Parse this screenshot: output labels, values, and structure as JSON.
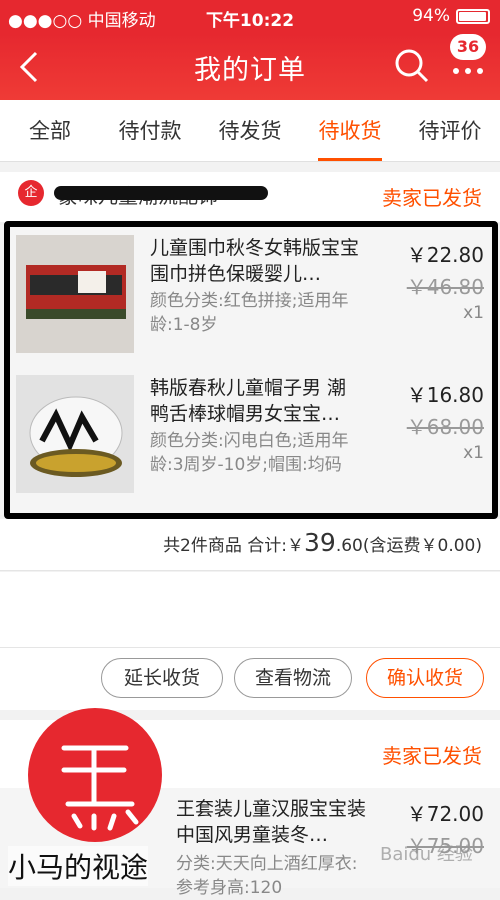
{
  "status_bar": {
    "carrier": "●●●○○ 中国移动",
    "time": "下午10:22",
    "battery": "94%"
  },
  "nav": {
    "back_icon": "chevron-left-icon",
    "title": "我的订单",
    "badge_count": "36"
  },
  "tabs": [
    {
      "label": "全部"
    },
    {
      "label": "待付款"
    },
    {
      "label": "待发货"
    },
    {
      "label": "待收货",
      "active": true
    },
    {
      "label": "待评价"
    }
  ],
  "order1": {
    "shop_icon_text": "企",
    "shop_name": "蒙味儿童潮流配饰",
    "status": "卖家已发货",
    "items": [
      {
        "title": "儿童围巾秋冬女韩版宝宝围巾拼色保暖婴儿…",
        "spec": "颜色分类:红色拼接;适用年龄:1-8岁",
        "price": "￥22.80",
        "original_price": "￥46.80",
        "quantity": "x1"
      },
      {
        "title": "韩版春秋儿童帽子男 潮鸭舌棒球帽男女宝宝…",
        "spec": "颜色分类:闪电白色;适用年龄:3周岁-10岁;帽围:均码",
        "price": "￥16.80",
        "original_price": "￥68.00",
        "quantity": "x1"
      }
    ],
    "summary_prefix": "共2件商品 合计:￥",
    "total_int": "39",
    "total_dec": ".60",
    "summary_suffix": "(含运费￥0.00)",
    "buttons": {
      "extend": "延长收货",
      "logistics": "查看物流",
      "confirm": "确认收货"
    }
  },
  "order2": {
    "status": "卖家已发货",
    "item_title": "王套装儿童汉服宝宝装中国风男童装冬…",
    "item_spec": "分类:天天向上酒红厚衣:参考身高:120",
    "price": "￥72.00",
    "original_price": "￥75.00"
  },
  "watermark": {
    "label": "小马的视途",
    "baidu": "Baidu 经验"
  },
  "colors": {
    "brand_red": "#e6282f",
    "accent_orange": "#ff5000"
  }
}
